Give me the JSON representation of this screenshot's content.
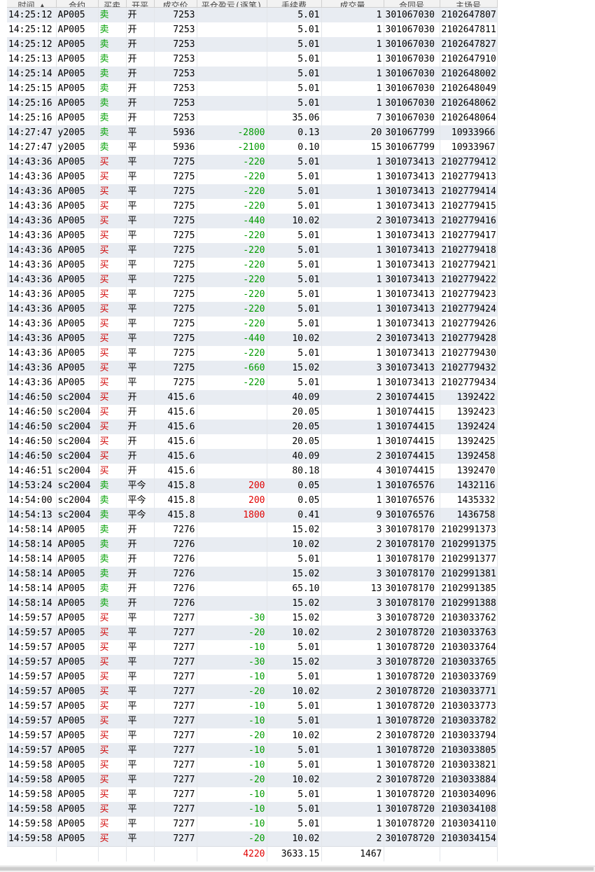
{
  "columns": {
    "time": "时间 ▲",
    "contract": "合约",
    "side": "买卖",
    "open_close": "开平",
    "price": "成交价",
    "pnl": "平仓盈亏(逐笔)",
    "fee": "手续费",
    "volume": "成交量",
    "order_no": "合同号",
    "deal_no": "主场号"
  },
  "rows": [
    [
      "14:25:12",
      "AP005",
      "卖",
      "开",
      "7253",
      "",
      "5.01",
      "1",
      "301067030",
      "2102647807"
    ],
    [
      "14:25:12",
      "AP005",
      "卖",
      "开",
      "7253",
      "",
      "5.01",
      "1",
      "301067030",
      "2102647811"
    ],
    [
      "14:25:12",
      "AP005",
      "卖",
      "开",
      "7253",
      "",
      "5.01",
      "1",
      "301067030",
      "2102647827"
    ],
    [
      "14:25:13",
      "AP005",
      "卖",
      "开",
      "7253",
      "",
      "5.01",
      "1",
      "301067030",
      "2102647910"
    ],
    [
      "14:25:14",
      "AP005",
      "卖",
      "开",
      "7253",
      "",
      "5.01",
      "1",
      "301067030",
      "2102648002"
    ],
    [
      "14:25:15",
      "AP005",
      "卖",
      "开",
      "7253",
      "",
      "5.01",
      "1",
      "301067030",
      "2102648049"
    ],
    [
      "14:25:16",
      "AP005",
      "卖",
      "开",
      "7253",
      "",
      "5.01",
      "1",
      "301067030",
      "2102648062"
    ],
    [
      "14:25:16",
      "AP005",
      "卖",
      "开",
      "7253",
      "",
      "35.06",
      "7",
      "301067030",
      "2102648064"
    ],
    [
      "14:27:47",
      "y2005",
      "卖",
      "平",
      "5936",
      "-2800",
      "0.13",
      "20",
      "301067799",
      "10933966"
    ],
    [
      "14:27:47",
      "y2005",
      "卖",
      "平",
      "5936",
      "-2100",
      "0.10",
      "15",
      "301067799",
      "10933967"
    ],
    [
      "14:43:36",
      "AP005",
      "买",
      "平",
      "7275",
      "-220",
      "5.01",
      "1",
      "301073413",
      "2102779412"
    ],
    [
      "14:43:36",
      "AP005",
      "买",
      "平",
      "7275",
      "-220",
      "5.01",
      "1",
      "301073413",
      "2102779413"
    ],
    [
      "14:43:36",
      "AP005",
      "买",
      "平",
      "7275",
      "-220",
      "5.01",
      "1",
      "301073413",
      "2102779414"
    ],
    [
      "14:43:36",
      "AP005",
      "买",
      "平",
      "7275",
      "-220",
      "5.01",
      "1",
      "301073413",
      "2102779415"
    ],
    [
      "14:43:36",
      "AP005",
      "买",
      "平",
      "7275",
      "-440",
      "10.02",
      "2",
      "301073413",
      "2102779416"
    ],
    [
      "14:43:36",
      "AP005",
      "买",
      "平",
      "7275",
      "-220",
      "5.01",
      "1",
      "301073413",
      "2102779417"
    ],
    [
      "14:43:36",
      "AP005",
      "买",
      "平",
      "7275",
      "-220",
      "5.01",
      "1",
      "301073413",
      "2102779418"
    ],
    [
      "14:43:36",
      "AP005",
      "买",
      "平",
      "7275",
      "-220",
      "5.01",
      "1",
      "301073413",
      "2102779421"
    ],
    [
      "14:43:36",
      "AP005",
      "买",
      "平",
      "7275",
      "-220",
      "5.01",
      "1",
      "301073413",
      "2102779422"
    ],
    [
      "14:43:36",
      "AP005",
      "买",
      "平",
      "7275",
      "-220",
      "5.01",
      "1",
      "301073413",
      "2102779423"
    ],
    [
      "14:43:36",
      "AP005",
      "买",
      "平",
      "7275",
      "-220",
      "5.01",
      "1",
      "301073413",
      "2102779424"
    ],
    [
      "14:43:36",
      "AP005",
      "买",
      "平",
      "7275",
      "-220",
      "5.01",
      "1",
      "301073413",
      "2102779426"
    ],
    [
      "14:43:36",
      "AP005",
      "买",
      "平",
      "7275",
      "-440",
      "10.02",
      "2",
      "301073413",
      "2102779428"
    ],
    [
      "14:43:36",
      "AP005",
      "买",
      "平",
      "7275",
      "-220",
      "5.01",
      "1",
      "301073413",
      "2102779430"
    ],
    [
      "14:43:36",
      "AP005",
      "买",
      "平",
      "7275",
      "-660",
      "15.02",
      "3",
      "301073413",
      "2102779432"
    ],
    [
      "14:43:36",
      "AP005",
      "买",
      "平",
      "7275",
      "-220",
      "5.01",
      "1",
      "301073413",
      "2102779434"
    ],
    [
      "14:46:50",
      "sc2004",
      "买",
      "开",
      "415.6",
      "",
      "40.09",
      "2",
      "301074415",
      "1392422"
    ],
    [
      "14:46:50",
      "sc2004",
      "买",
      "开",
      "415.6",
      "",
      "20.05",
      "1",
      "301074415",
      "1392423"
    ],
    [
      "14:46:50",
      "sc2004",
      "买",
      "开",
      "415.6",
      "",
      "20.05",
      "1",
      "301074415",
      "1392424"
    ],
    [
      "14:46:50",
      "sc2004",
      "买",
      "开",
      "415.6",
      "",
      "20.05",
      "1",
      "301074415",
      "1392425"
    ],
    [
      "14:46:50",
      "sc2004",
      "买",
      "开",
      "415.6",
      "",
      "40.09",
      "2",
      "301074415",
      "1392458"
    ],
    [
      "14:46:51",
      "sc2004",
      "买",
      "开",
      "415.6",
      "",
      "80.18",
      "4",
      "301074415",
      "1392470"
    ],
    [
      "14:53:24",
      "sc2004",
      "卖",
      "平今",
      "415.8",
      "200",
      "0.05",
      "1",
      "301076576",
      "1432116"
    ],
    [
      "14:54:00",
      "sc2004",
      "卖",
      "平今",
      "415.8",
      "200",
      "0.05",
      "1",
      "301076576",
      "1435332"
    ],
    [
      "14:54:13",
      "sc2004",
      "卖",
      "平今",
      "415.8",
      "1800",
      "0.41",
      "9",
      "301076576",
      "1436758"
    ],
    [
      "14:58:14",
      "AP005",
      "卖",
      "开",
      "7276",
      "",
      "15.02",
      "3",
      "301078170",
      "2102991373"
    ],
    [
      "14:58:14",
      "AP005",
      "卖",
      "开",
      "7276",
      "",
      "10.02",
      "2",
      "301078170",
      "2102991375"
    ],
    [
      "14:58:14",
      "AP005",
      "卖",
      "开",
      "7276",
      "",
      "5.01",
      "1",
      "301078170",
      "2102991377"
    ],
    [
      "14:58:14",
      "AP005",
      "卖",
      "开",
      "7276",
      "",
      "15.02",
      "3",
      "301078170",
      "2102991381"
    ],
    [
      "14:58:14",
      "AP005",
      "卖",
      "开",
      "7276",
      "",
      "65.10",
      "13",
      "301078170",
      "2102991385"
    ],
    [
      "14:58:14",
      "AP005",
      "卖",
      "开",
      "7276",
      "",
      "15.02",
      "3",
      "301078170",
      "2102991388"
    ],
    [
      "14:59:57",
      "AP005",
      "买",
      "平",
      "7277",
      "-30",
      "15.02",
      "3",
      "301078720",
      "2103033762"
    ],
    [
      "14:59:57",
      "AP005",
      "买",
      "平",
      "7277",
      "-20",
      "10.02",
      "2",
      "301078720",
      "2103033763"
    ],
    [
      "14:59:57",
      "AP005",
      "买",
      "平",
      "7277",
      "-10",
      "5.01",
      "1",
      "301078720",
      "2103033764"
    ],
    [
      "14:59:57",
      "AP005",
      "买",
      "平",
      "7277",
      "-30",
      "15.02",
      "3",
      "301078720",
      "2103033765"
    ],
    [
      "14:59:57",
      "AP005",
      "买",
      "平",
      "7277",
      "-10",
      "5.01",
      "1",
      "301078720",
      "2103033769"
    ],
    [
      "14:59:57",
      "AP005",
      "买",
      "平",
      "7277",
      "-20",
      "10.02",
      "2",
      "301078720",
      "2103033771"
    ],
    [
      "14:59:57",
      "AP005",
      "买",
      "平",
      "7277",
      "-10",
      "5.01",
      "1",
      "301078720",
      "2103033773"
    ],
    [
      "14:59:57",
      "AP005",
      "买",
      "平",
      "7277",
      "-10",
      "5.01",
      "1",
      "301078720",
      "2103033782"
    ],
    [
      "14:59:57",
      "AP005",
      "买",
      "平",
      "7277",
      "-20",
      "10.02",
      "2",
      "301078720",
      "2103033794"
    ],
    [
      "14:59:57",
      "AP005",
      "买",
      "平",
      "7277",
      "-10",
      "5.01",
      "1",
      "301078720",
      "2103033805"
    ],
    [
      "14:59:58",
      "AP005",
      "买",
      "平",
      "7277",
      "-10",
      "5.01",
      "1",
      "301078720",
      "2103033821"
    ],
    [
      "14:59:58",
      "AP005",
      "买",
      "平",
      "7277",
      "-20",
      "10.02",
      "2",
      "301078720",
      "2103033884"
    ],
    [
      "14:59:58",
      "AP005",
      "买",
      "平",
      "7277",
      "-10",
      "5.01",
      "1",
      "301078720",
      "2103034096"
    ],
    [
      "14:59:58",
      "AP005",
      "买",
      "平",
      "7277",
      "-10",
      "5.01",
      "1",
      "301078720",
      "2103034108"
    ],
    [
      "14:59:58",
      "AP005",
      "买",
      "平",
      "7277",
      "-10",
      "5.01",
      "1",
      "301078720",
      "2103034110"
    ],
    [
      "14:59:58",
      "AP005",
      "买",
      "平",
      "7277",
      "-20",
      "10.02",
      "2",
      "301078720",
      "2103034154"
    ]
  ],
  "totals": {
    "pnl": "4220",
    "fee": "3633.15",
    "volume": "1467"
  },
  "colors": {
    "buy": "#d00000",
    "sell": "#00a000",
    "profit": "#e00000",
    "loss": "#009a00",
    "row_alt": "#e8ecf2"
  }
}
